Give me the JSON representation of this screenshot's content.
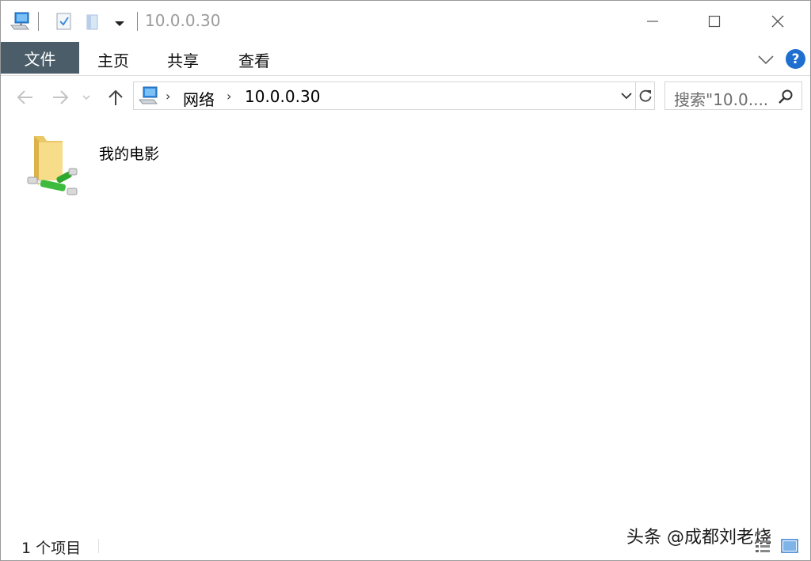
{
  "window": {
    "title": "10.0.0.30",
    "controls": {
      "minimize": "minimize-icon",
      "maximize": "maximize-icon",
      "close": "close-icon"
    }
  },
  "quick_access": {
    "icons": [
      "computer-network-icon",
      "properties-icon",
      "new-folder-icon",
      "dropdown-arrow-icon"
    ]
  },
  "ribbon": {
    "file_tab": "文件",
    "tabs": [
      "主页",
      "共享",
      "查看"
    ],
    "help_label": "?"
  },
  "navigation": {
    "back": "back-arrow-icon",
    "forward": "forward-arrow-icon",
    "recent": "recent-dropdown-icon",
    "up": "up-arrow-icon",
    "breadcrumbs": [
      "网络",
      "10.0.0.30"
    ],
    "search_placeholder": "搜索\"10.0...."
  },
  "content": {
    "items": [
      {
        "label": "我的电影",
        "icon": "shared-folder-icon"
      }
    ]
  },
  "status": {
    "item_count": "1 个项目",
    "watermark": "头条 @成都刘老烧"
  },
  "colors": {
    "file_tab_bg": "#4a5d68",
    "help_bg": "#1f6fd0",
    "accent_blue": "#2b7cd3"
  }
}
